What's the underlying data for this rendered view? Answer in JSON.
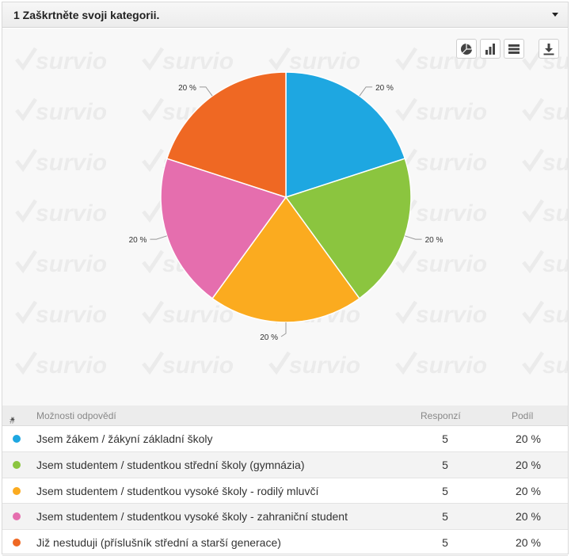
{
  "question": {
    "title": "1 Zaškrtněte svoji kategorii."
  },
  "watermark": "survio",
  "toolbar": {
    "pie": "pie-chart-icon",
    "bar": "bar-chart-icon",
    "table": "table-view-icon",
    "download": "download-icon"
  },
  "chart_data": {
    "type": "pie",
    "categories": [
      "Jsem žákem / žákyní základní školy",
      "Jsem studentem / studentkou střední školy (gymnázia)",
      "Jsem studentem / studentkou vysoké školy - rodilý mluvčí",
      "Jsem studentem / studentkou vysoké školy - zahraniční student",
      "Již nestuduji (příslušník střední a starší generace)"
    ],
    "values": [
      20,
      20,
      20,
      20,
      20
    ],
    "labels": [
      "20 %",
      "20 %",
      "20 %",
      "20 %",
      "20 %"
    ],
    "colors": [
      "#1ea7e1",
      "#8bc53f",
      "#fbab1f",
      "#e56eae",
      "#ef6823"
    ]
  },
  "table": {
    "headers": {
      "num": "#",
      "options": "Možnosti odpovědí",
      "responses": "Responzí",
      "share": "Podíl"
    },
    "rows": [
      {
        "label": "Jsem žákem / žákyní základní školy",
        "responses": "5",
        "share": "20 %",
        "color": "#1ea7e1"
      },
      {
        "label": "Jsem studentem / studentkou střední školy (gymnázia)",
        "responses": "5",
        "share": "20 %",
        "color": "#8bc53f"
      },
      {
        "label": "Jsem studentem / studentkou vysoké školy - rodilý mluvčí",
        "responses": "5",
        "share": "20 %",
        "color": "#fbab1f"
      },
      {
        "label": "Jsem studentem / studentkou vysoké školy - zahraniční student",
        "responses": "5",
        "share": "20 %",
        "color": "#e56eae"
      },
      {
        "label": "Již nestuduji (příslušník střední a starší generace)",
        "responses": "5",
        "share": "20 %",
        "color": "#ef6823"
      }
    ]
  }
}
